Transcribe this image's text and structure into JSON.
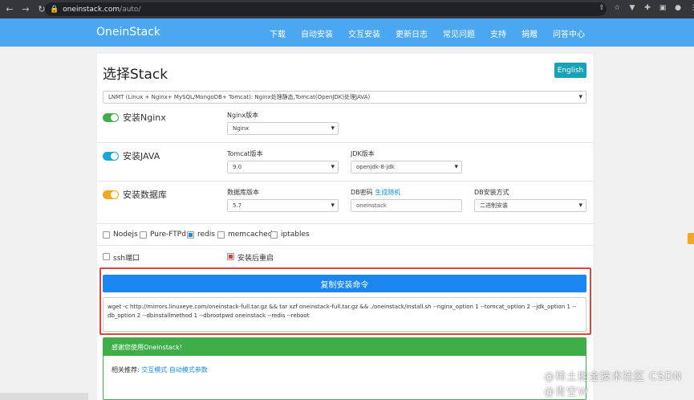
{
  "browser": {
    "url_domain": "oneinstack.com",
    "url_path": "/auto/"
  },
  "header": {
    "brand": "OneinStack",
    "nav": [
      "下载",
      "自动安装",
      "交互安装",
      "更新日志",
      "常见问题",
      "支持",
      "捐赠",
      "问答中心"
    ]
  },
  "page": {
    "title": "选择Stack",
    "lang_button": "English",
    "stack_select": "LNMT (Linux + Nginx+ MySQL/MongoDB+ Tomcat): Nginx处理静态,Tomcat(OpenJDK)处理JAVA)"
  },
  "nginx": {
    "toggle_label": "安装Nginx",
    "version_label": "Nginx版本",
    "version_value": "Nginx"
  },
  "java": {
    "toggle_label": "安装JAVA",
    "tomcat_label": "Tomcat版本",
    "tomcat_value": "9.0",
    "jdk_label": "JDK版本",
    "jdk_value": "openjdk-8-jdk"
  },
  "db": {
    "toggle_label": "安装数据库",
    "version_label": "数据库版本",
    "version_value": "5.7",
    "password_label": "DB密码",
    "password_link": "生成随机",
    "password_value": "oneinstack",
    "method_label": "DB安装方式",
    "method_value": "二进制安装"
  },
  "options": {
    "nodejs": "Nodejs",
    "pureftpd": "Pure-FTPd",
    "redis": "redis",
    "memcached": "memcached",
    "iptables": "iptables",
    "ssh": "ssh端口",
    "reboot": "安装后重启"
  },
  "command": {
    "copy_button": "复制安装命令",
    "text": "wget -c http://mirrors.linuxeye.com/oneinstack-full.tar.gz && tar xzf oneinstack-full.tar.gz && ./oneinstack/install.sh --nginx_option 1 --tomcat_option 2 --jdk_option 1 --db_option 2 --dbinstallmethod 1 --dbrootpwd oneinstack --redis --reboot"
  },
  "thanks": {
    "heading": "感谢您使用Oneinstack!",
    "prefix": "相关推荐:",
    "link1": "交互模式",
    "link2": "自动模式参数"
  },
  "watermark": "@稀土掘金技术社区 CSDN @青空W",
  "colors": {
    "header": "#4aa7f0",
    "toggle_nginx": "#3fae49",
    "toggle_java": "#1aa7d8",
    "toggle_db": "#f5a623",
    "primary": "#1a86f0",
    "success": "#3fae49",
    "info": "#17a2b8"
  }
}
